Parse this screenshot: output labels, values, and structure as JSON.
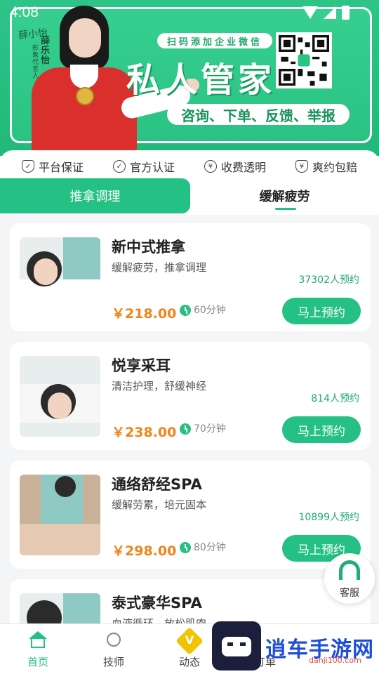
{
  "status_bar": {
    "time": "4:08"
  },
  "banner": {
    "spokesperson_name": "薛乐怡",
    "spokesperson_role": "形象代言人",
    "signature": "薛小怡",
    "scan_tag": "扫码添加企业微信",
    "title": "私人管家",
    "services": "咨询、下单、反馈、举报"
  },
  "guarantees": [
    {
      "label": "平台保证",
      "icon": "shield-check-icon"
    },
    {
      "label": "官方认证",
      "icon": "badge-check-icon"
    },
    {
      "label": "收费透明",
      "icon": "yuan-circle-icon"
    },
    {
      "label": "爽约包赔",
      "icon": "yuan-shield-icon"
    }
  ],
  "tabs": [
    {
      "label": "推拿调理",
      "active": true
    },
    {
      "label": "缓解疲劳",
      "active": false
    }
  ],
  "services_list": [
    {
      "title": "新中式推拿",
      "subtitle": "缓解疲劳，推拿调理",
      "bookings": "37302人预约",
      "price": "￥218.00",
      "duration": "60分钟",
      "button": "马上预约"
    },
    {
      "title": "悦享采耳",
      "subtitle": "清洁护理，舒缓神经",
      "bookings": "814人预约",
      "price": "￥238.00",
      "duration": "70分钟",
      "button": "马上预约"
    },
    {
      "title": "通络舒经SPA",
      "subtitle": "缓解劳累，培元固本",
      "bookings": "10899人预约",
      "price": "￥298.00",
      "duration": "80分钟",
      "button": "马上预约"
    },
    {
      "title": "泰式豪华SPA",
      "subtitle": "血液循环，放松肌肉"
    }
  ],
  "customer_service": {
    "label": "客服"
  },
  "bottom_nav": [
    {
      "label": "首页",
      "icon": "home-icon",
      "active": true
    },
    {
      "label": "技师",
      "icon": "technician-icon",
      "active": false
    },
    {
      "label": "动态",
      "icon": "dynamic-icon",
      "active": false
    },
    {
      "label": "订单",
      "icon": "order-icon",
      "active": false
    }
  ],
  "watermark": {
    "text": "逍车手游网",
    "url": "danji100.com"
  },
  "colors": {
    "brand_green": "#25c083",
    "price_orange": "#f08418",
    "count_green": "#1faa73"
  }
}
